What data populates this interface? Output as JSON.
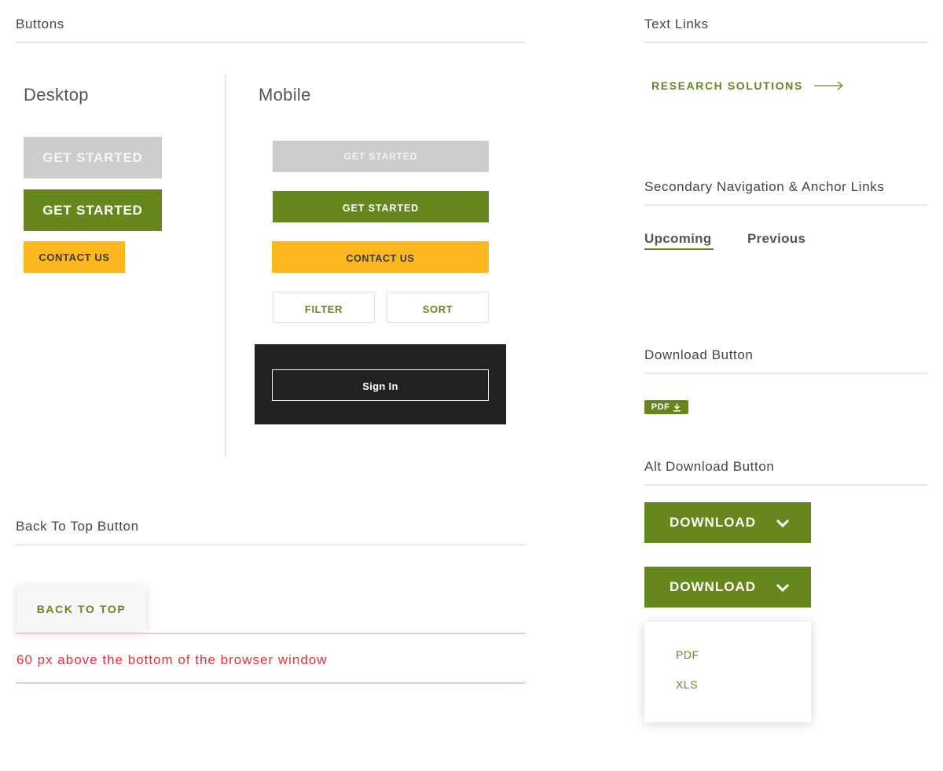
{
  "buttons_section": {
    "title": "Buttons",
    "desktop": {
      "heading": "Desktop",
      "disabled_label": "GET STARTED",
      "primary_label": "GET STARTED",
      "contact_label": "CONTACT US"
    },
    "mobile": {
      "heading": "Mobile",
      "disabled_label": "GET STARTED",
      "primary_label": "GET STARTED",
      "contact_label": "CONTACT US",
      "filter_label": "FILTER",
      "sort_label": "SORT",
      "signin_label": "Sign In"
    }
  },
  "back_to_top_section": {
    "title": "Back To Top Button",
    "button_label": "BACK TO TOP",
    "note": "60 px above the bottom of the browser window"
  },
  "text_links_section": {
    "title": "Text Links",
    "link_label": "RESEARCH SOLUTIONS"
  },
  "secondary_nav_section": {
    "title": "Secondary Navigation & Anchor Links",
    "items": [
      {
        "label": "Upcoming",
        "active": true
      },
      {
        "label": "Previous",
        "active": false
      }
    ]
  },
  "download_section": {
    "title": "Download Button",
    "badge_label": "PDF"
  },
  "alt_download_section": {
    "title": "Alt Download Button",
    "button_label": "DOWNLOAD",
    "button_label_open": "DOWNLOAD",
    "options": [
      "PDF",
      "XLS"
    ]
  },
  "colors": {
    "brand_green": "#66871c",
    "brand_yellow": "#fdb71e",
    "disabled_gray": "#cccccc",
    "dark_panel": "#222222",
    "note_red": "#e0313f"
  },
  "icons": {
    "text_link_arrow": "long-arrow-right-icon",
    "pdf_download": "download-icon",
    "dropdown_chevron": "chevron-down-icon"
  }
}
